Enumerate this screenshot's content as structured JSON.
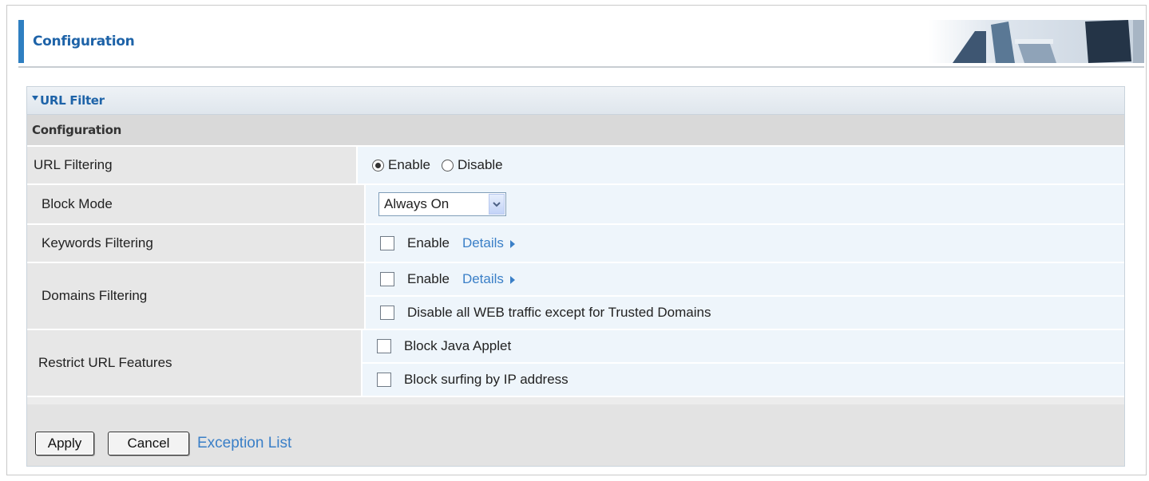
{
  "header": {
    "title": "Configuration"
  },
  "section": {
    "title": "URL Filter",
    "subtitle": "Configuration"
  },
  "rows": {
    "url_filtering": {
      "label": "URL Filtering",
      "enable_label": "Enable",
      "disable_label": "Disable",
      "selected": "Enable"
    },
    "block_mode": {
      "label": "Block Mode",
      "value": "Always On"
    },
    "keywords_filtering": {
      "label": "Keywords Filtering",
      "enable_label": "Enable",
      "details_label": "Details"
    },
    "domains_filtering": {
      "label": "Domains Filtering",
      "enable_label": "Enable",
      "details_label": "Details",
      "trusted_label": "Disable all WEB traffic except for Trusted Domains"
    },
    "restrict_url": {
      "label": "Restrict URL Features",
      "java_label": "Block Java Applet",
      "ip_label": "Block surfing by IP address"
    }
  },
  "footer": {
    "apply_label": "Apply",
    "cancel_label": "Cancel",
    "exception_label": "Exception List"
  },
  "colors": {
    "accent": "#2f7fc1",
    "link": "#3a7fc7",
    "title": "#1e63a8"
  }
}
